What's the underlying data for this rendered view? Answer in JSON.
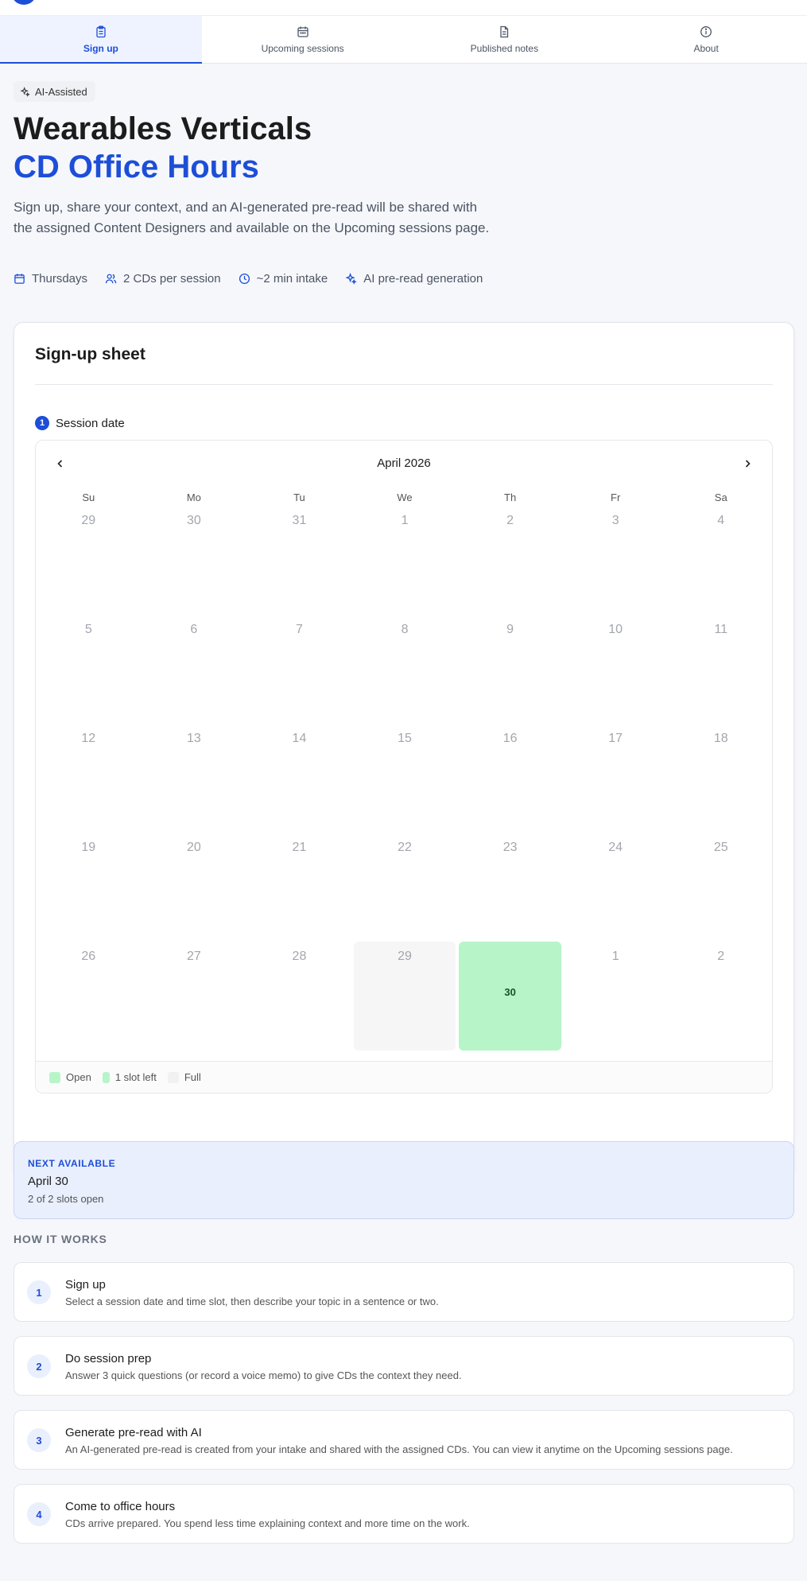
{
  "tabs": [
    {
      "label": "Sign up",
      "icon": "clipboard-icon"
    },
    {
      "label": "Upcoming sessions",
      "icon": "calendar-icon"
    },
    {
      "label": "Published notes",
      "icon": "document-icon"
    },
    {
      "label": "About",
      "icon": "info-icon"
    }
  ],
  "header": {
    "badge": "AI-Assisted",
    "title_line1": "Wearables Verticals",
    "title_line2": "CD Office Hours",
    "lede": "Sign up, share your context, and an AI-generated pre-read will be shared with the assigned Content Designers and available on the Upcoming sessions page."
  },
  "meta": [
    {
      "label": "Thursdays",
      "icon": "calendar-icon"
    },
    {
      "label": "2 CDs per session",
      "icon": "users-icon"
    },
    {
      "label": "~2 min intake",
      "icon": "clock-icon"
    },
    {
      "label": "AI pre-read generation",
      "icon": "sparkle-icon"
    }
  ],
  "signup": {
    "title": "Sign-up sheet",
    "step_number": "1",
    "step_label": "Session date",
    "calendar": {
      "month": "April 2026",
      "weekdays": [
        "Su",
        "Mo",
        "Tu",
        "We",
        "Th",
        "Fr",
        "Sa"
      ],
      "weeks": [
        [
          "29",
          "30",
          "31",
          "1",
          "2",
          "3",
          "4"
        ],
        [
          "5",
          "6",
          "7",
          "8",
          "9",
          "10",
          "11"
        ],
        [
          "12",
          "13",
          "14",
          "15",
          "16",
          "17",
          "18"
        ],
        [
          "19",
          "20",
          "21",
          "22",
          "23",
          "24",
          "25"
        ],
        [
          "26",
          "27",
          "28",
          "29",
          "30",
          "1",
          "2"
        ]
      ],
      "open_day": "30"
    },
    "legend": {
      "open": "Open",
      "one_left": "1 slot left",
      "full": "Full"
    }
  },
  "next_available": {
    "eyebrow": "NEXT AVAILABLE",
    "date": "April 30",
    "slots": "2 of 2 slots open"
  },
  "how_it_works": {
    "title": "HOW IT WORKS",
    "steps": [
      {
        "num": "1",
        "title": "Sign up",
        "desc": "Select a session date and time slot, then describe your topic in a sentence or two."
      },
      {
        "num": "2",
        "title": "Do session prep",
        "desc": "Answer 3 quick questions (or record a voice memo) to give CDs the context they need."
      },
      {
        "num": "3",
        "title": "Generate pre-read with AI",
        "desc": "An AI-generated pre-read is created from your intake and shared with the assigned CDs. You can view it anytime on the Upcoming sessions page."
      },
      {
        "num": "4",
        "title": "Come to office hours",
        "desc": "CDs arrive prepared. You spend less time explaining context and more time on the work."
      }
    ]
  },
  "colors": {
    "accent": "#1d4ed8",
    "open": "#b7f5c9",
    "full": "#f1f1f1"
  }
}
